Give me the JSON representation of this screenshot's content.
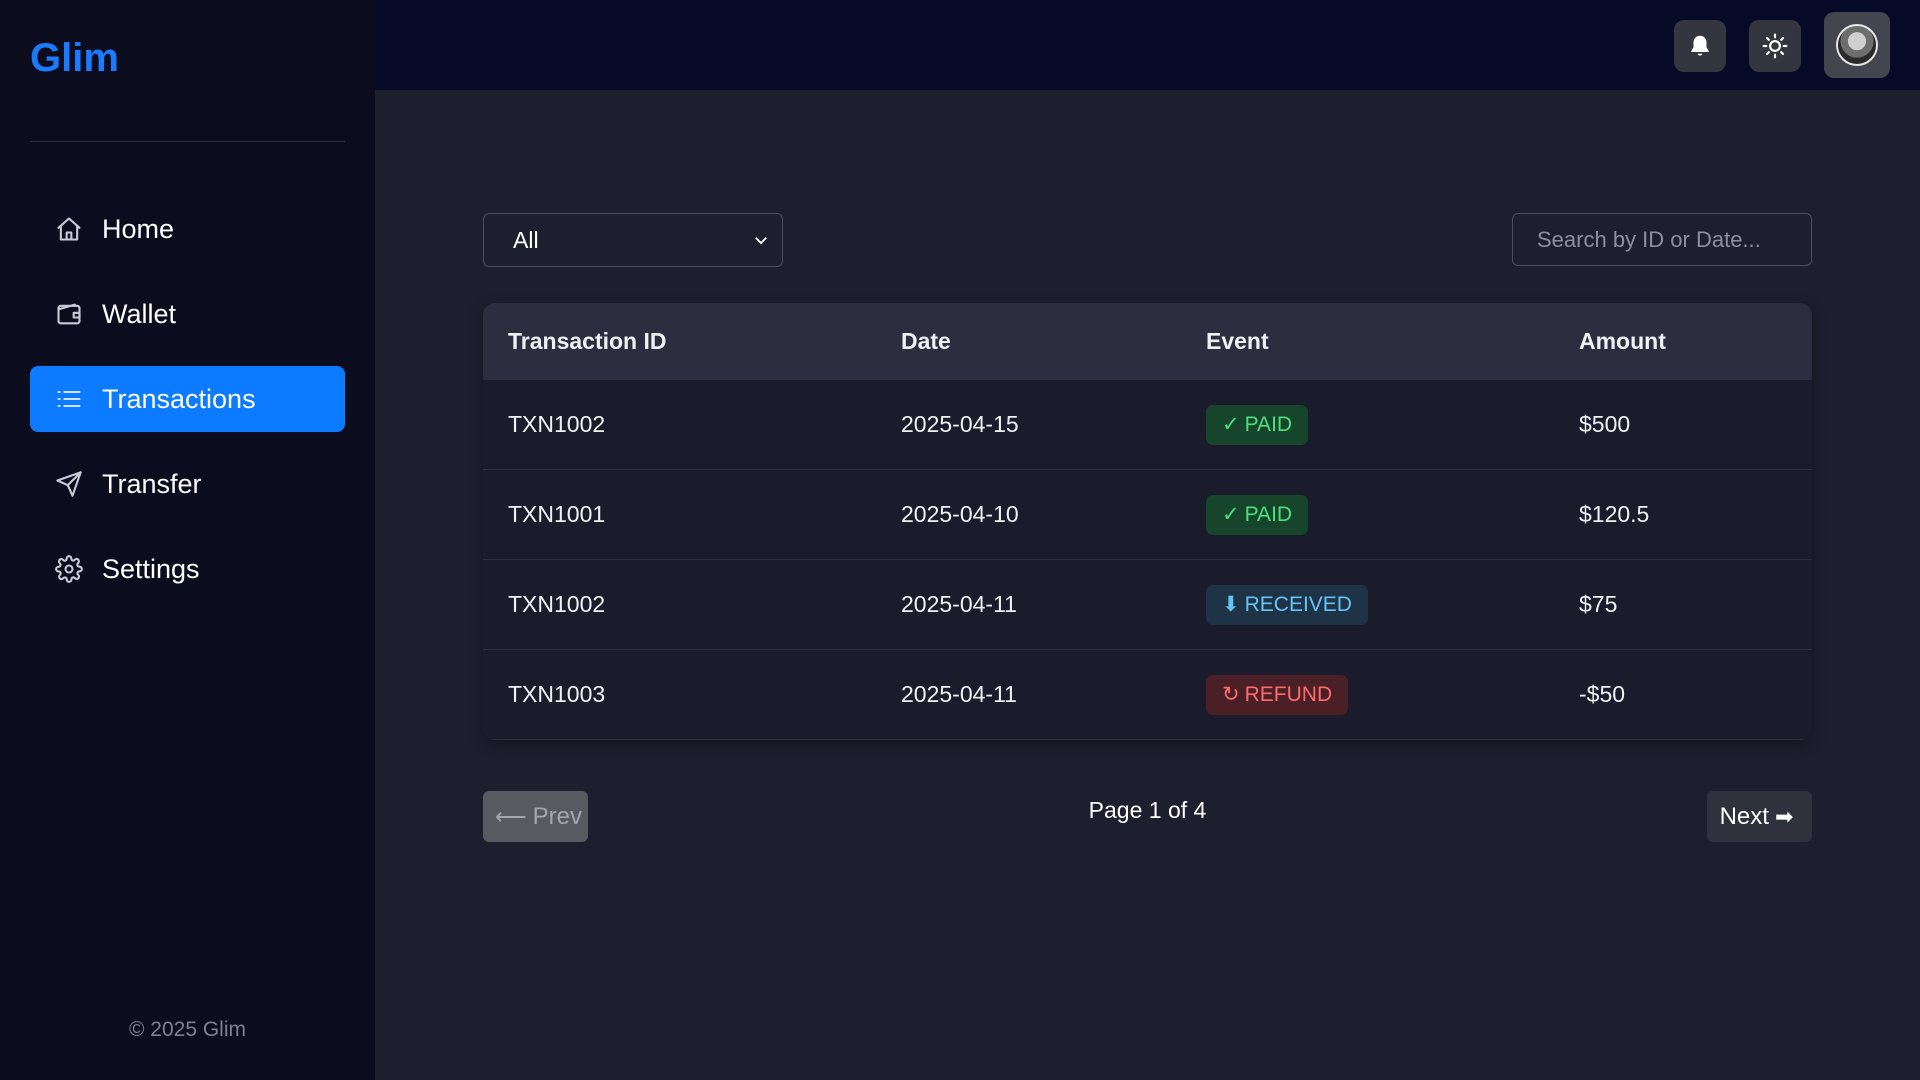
{
  "brand": "Glim",
  "sidebar": {
    "items": [
      {
        "label": "Home",
        "icon": "home-icon",
        "active": false
      },
      {
        "label": "Wallet",
        "icon": "wallet-icon",
        "active": false
      },
      {
        "label": "Transactions",
        "icon": "list-icon",
        "active": true
      },
      {
        "label": "Transfer",
        "icon": "send-icon",
        "active": false
      },
      {
        "label": "Settings",
        "icon": "gear-icon",
        "active": false
      }
    ],
    "copyright": "© 2025 Glim"
  },
  "topbar": {
    "icons": [
      "bell-icon",
      "sun-icon",
      "avatar"
    ]
  },
  "filters": {
    "event_filter": "All",
    "search_placeholder": "Search by ID or Date..."
  },
  "table": {
    "headers": [
      "Transaction ID",
      "Date",
      "Event",
      "Amount"
    ],
    "rows": [
      {
        "id": "TXN1002",
        "date": "2025-04-15",
        "event_symbol": "✓",
        "event": "PAID",
        "event_type": "paid",
        "amount": "$500"
      },
      {
        "id": "TXN1001",
        "date": "2025-04-10",
        "event_symbol": "✓",
        "event": "PAID",
        "event_type": "paid",
        "amount": "$120.5"
      },
      {
        "id": "TXN1002",
        "date": "2025-04-11",
        "event_symbol": "⬇",
        "event": "RECEIVED",
        "event_type": "received",
        "amount": "$75"
      },
      {
        "id": "TXN1003",
        "date": "2025-04-11",
        "event_symbol": "↻",
        "event": "REFUND",
        "event_type": "refund",
        "amount": "-$50"
      }
    ]
  },
  "pagination": {
    "prev_arrow": "⟵",
    "prev_label": "Prev",
    "page_info": "Page 1 of 4",
    "next_label": "Next",
    "next_arrow": "➡"
  },
  "colors": {
    "accent": "#0d7bff",
    "sidebar_bg": "#0b0c1d",
    "topbar_bg": "#070a27",
    "main_bg": "#1e1f2e",
    "paid": "#4ee07c",
    "received": "#66c3f5",
    "refund": "#ff6b6b"
  }
}
